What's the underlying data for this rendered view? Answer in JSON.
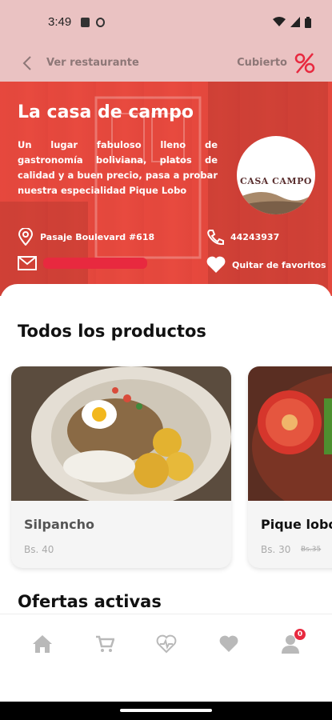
{
  "status_bar": {
    "time": "3:49"
  },
  "app_bar": {
    "title": "Ver restaurante",
    "open_status": "Cubierto"
  },
  "restaurant": {
    "name": "La casa de campo",
    "description": "Un lugar fabuloso lleno de gastronomía boliviana, platos de calidad y a buen precio, pasa a probar nuestra especialidad Pique Lobo",
    "logo_text": "CASA CAMPO",
    "address": "Pasaje Boulevard #618",
    "phone": "44243937",
    "favorite_label": "Quitar de favoritos"
  },
  "sections": {
    "products_title": "Todos los productos",
    "offers_title": "Ofertas activas"
  },
  "products": [
    {
      "name": "Silpancho",
      "price": "Bs. 40",
      "old_price": ""
    },
    {
      "name": "Pique lobo",
      "price": "Bs. 30",
      "old_price": "Bs.35"
    }
  ],
  "nav": {
    "items": [
      "home-icon",
      "cart-icon",
      "health-icon",
      "heart-icon",
      "user-icon"
    ],
    "badge_count": "0"
  },
  "colors": {
    "accent": "#e8293f",
    "hero": "#ec483e",
    "appbar": "#eac2c2"
  }
}
